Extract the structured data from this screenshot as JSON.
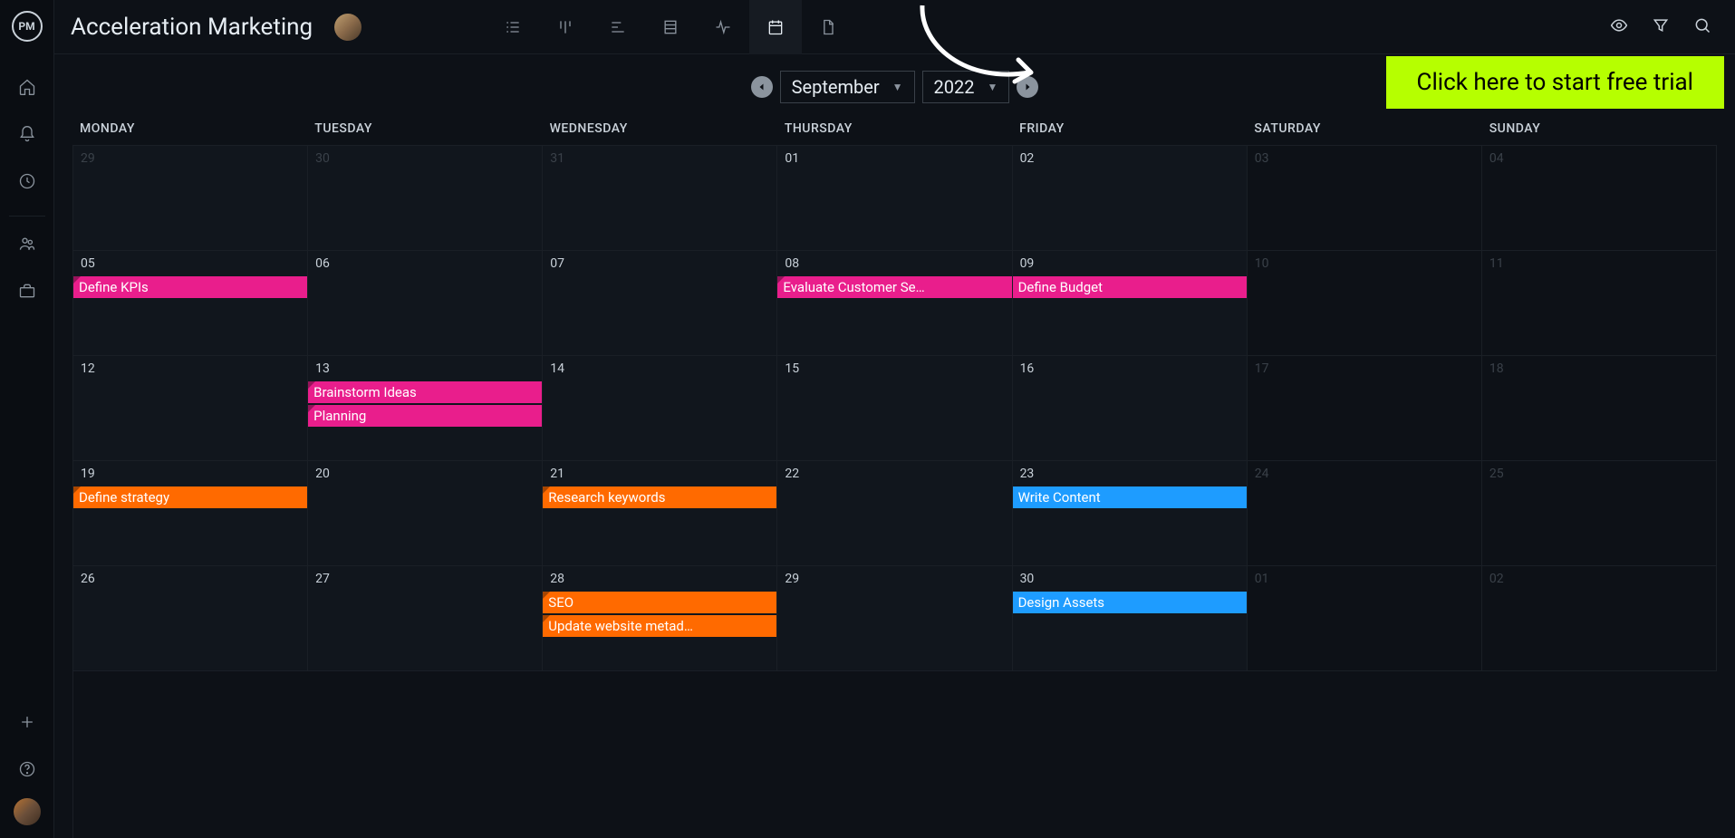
{
  "app": {
    "logo_text": "PM"
  },
  "header": {
    "title": "Acceleration Marketing"
  },
  "cta": {
    "label": "Click here to start free trial"
  },
  "calendar": {
    "month_label": "September",
    "year_label": "2022",
    "daynames": [
      "MONDAY",
      "TUESDAY",
      "WEDNESDAY",
      "THURSDAY",
      "FRIDAY",
      "SATURDAY",
      "SUNDAY"
    ],
    "weeks": [
      [
        {
          "n": "29",
          "out": true
        },
        {
          "n": "30",
          "out": true
        },
        {
          "n": "31",
          "out": true
        },
        {
          "n": "01"
        },
        {
          "n": "02"
        },
        {
          "n": "03",
          "we": true,
          "out": true
        },
        {
          "n": "04",
          "we": true,
          "out": true
        }
      ],
      [
        {
          "n": "05"
        },
        {
          "n": "06"
        },
        {
          "n": "07"
        },
        {
          "n": "08"
        },
        {
          "n": "09"
        },
        {
          "n": "10",
          "we": true,
          "out": true
        },
        {
          "n": "11",
          "we": true,
          "out": true
        }
      ],
      [
        {
          "n": "12"
        },
        {
          "n": "13"
        },
        {
          "n": "14"
        },
        {
          "n": "15"
        },
        {
          "n": "16"
        },
        {
          "n": "17",
          "we": true,
          "out": true
        },
        {
          "n": "18",
          "we": true,
          "out": true
        }
      ],
      [
        {
          "n": "19"
        },
        {
          "n": "20"
        },
        {
          "n": "21"
        },
        {
          "n": "22"
        },
        {
          "n": "23"
        },
        {
          "n": "24",
          "we": true,
          "out": true
        },
        {
          "n": "25",
          "we": true,
          "out": true
        }
      ],
      [
        {
          "n": "26"
        },
        {
          "n": "27"
        },
        {
          "n": "28"
        },
        {
          "n": "29"
        },
        {
          "n": "30"
        },
        {
          "n": "01",
          "we": true,
          "out": true
        },
        {
          "n": "02",
          "we": true,
          "out": true
        }
      ]
    ],
    "events": [
      {
        "label": "Define KPIs",
        "color": "pink",
        "row": 1,
        "col": 0,
        "span": 1,
        "slot": 0,
        "corner": true
      },
      {
        "label": "Evaluate Customer Se…",
        "color": "pink",
        "row": 1,
        "col": 3,
        "span": 1,
        "slot": 0,
        "corner": true
      },
      {
        "label": "Define Budget",
        "color": "pink",
        "row": 1,
        "col": 4,
        "span": 1,
        "slot": 0
      },
      {
        "label": "Brainstorm Ideas",
        "color": "pink",
        "row": 2,
        "col": 1,
        "span": 1,
        "slot": 0,
        "corner": true
      },
      {
        "label": "Planning",
        "color": "pink",
        "row": 2,
        "col": 1,
        "span": 1,
        "slot": 1,
        "corner": true
      },
      {
        "label": "Define strategy",
        "color": "orange",
        "row": 3,
        "col": 0,
        "span": 1,
        "slot": 0,
        "corner": true
      },
      {
        "label": "Research keywords",
        "color": "orange",
        "row": 3,
        "col": 2,
        "span": 1,
        "slot": 0,
        "corner": true
      },
      {
        "label": "Write Content",
        "color": "blue",
        "row": 3,
        "col": 4,
        "span": 1,
        "slot": 0
      },
      {
        "label": "SEO",
        "color": "orange",
        "row": 4,
        "col": 2,
        "span": 1,
        "slot": 0,
        "corner": true
      },
      {
        "label": "Update website metad…",
        "color": "orange",
        "row": 4,
        "col": 2,
        "span": 1,
        "slot": 1,
        "corner": true
      },
      {
        "label": "Design Assets",
        "color": "blue",
        "row": 4,
        "col": 4,
        "span": 1,
        "slot": 0
      }
    ]
  }
}
